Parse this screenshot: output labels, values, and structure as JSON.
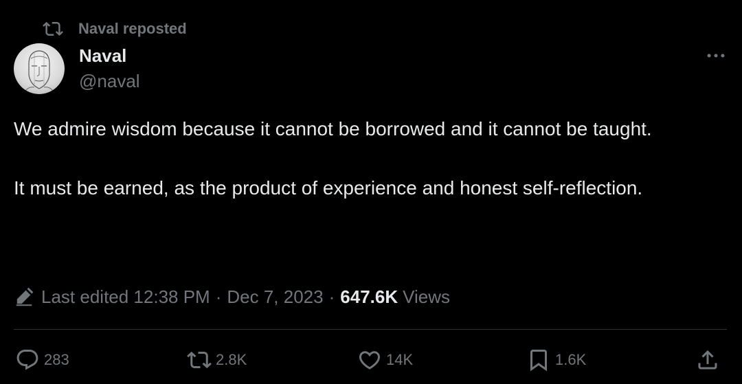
{
  "social_context": {
    "icon": "repost-icon",
    "text": "Naval reposted"
  },
  "author": {
    "display_name": "Naval",
    "handle": "@naval",
    "avatar_icon": "avatar-sketch"
  },
  "more_icon": "more-icon",
  "tweet": {
    "paragraphs": [
      "We admire wisdom because it cannot be borrowed and it cannot be taught.",
      "It must be earned, as the product of experience and honest self-reflection."
    ]
  },
  "meta": {
    "edit_icon": "pencil-icon",
    "edited_label": "Last edited 12:38 PM",
    "separator": "·",
    "date": "Dec 7, 2023",
    "views_count": "647.6K",
    "views_label": "Views"
  },
  "actions": {
    "reply": {
      "icon": "reply-icon",
      "count": "283"
    },
    "repost": {
      "icon": "repost-icon",
      "count": "2.8K"
    },
    "like": {
      "icon": "heart-icon",
      "count": "14K"
    },
    "bookmark": {
      "icon": "bookmark-icon",
      "count": "1.6K"
    },
    "share": {
      "icon": "share-icon"
    }
  },
  "colors": {
    "background": "#000000",
    "primary_text": "#e7e9ea",
    "secondary_text": "#71767b",
    "divider": "#2f3336"
  }
}
